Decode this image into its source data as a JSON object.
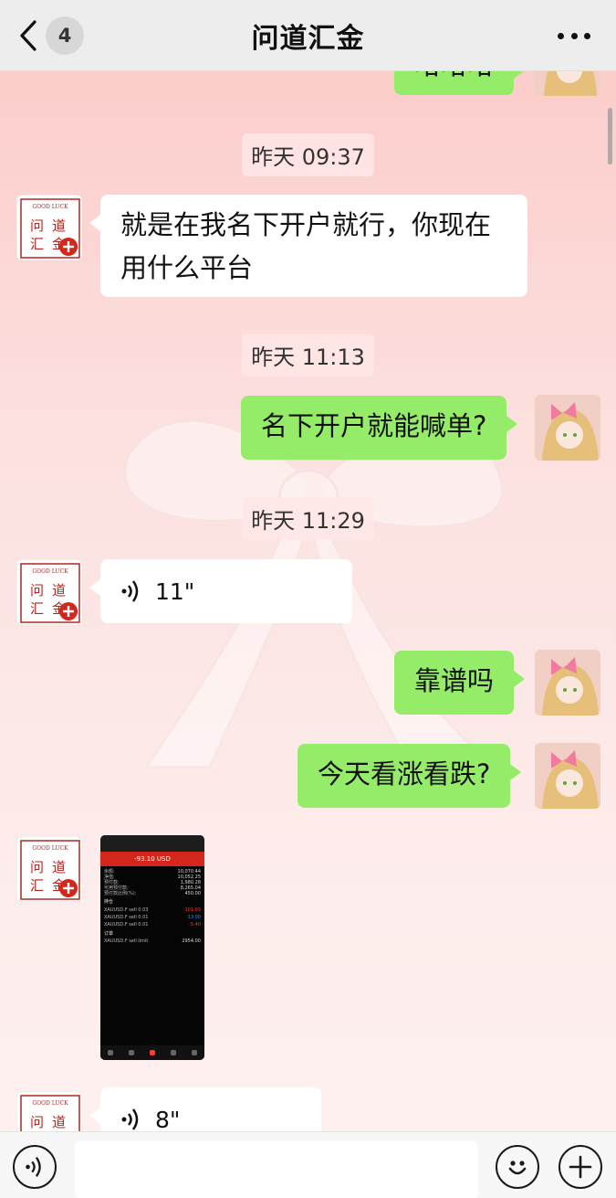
{
  "header": {
    "title": "问道汇金",
    "unread_count": "4"
  },
  "messages": {
    "partial_top": "哈哈哈",
    "ts1": "昨天 09:37",
    "m1": "就是在我名下开户就行，你现在用什么平台",
    "ts2": "昨天 11:13",
    "m2": "名下开户就能喊单?",
    "ts3": "昨天 11:29",
    "voice1": "11\"",
    "m3": "靠谱吗",
    "m4": "今天看涨看跌?",
    "voice2": "8\""
  },
  "thumbnail": {
    "header_value": "-93.10 USD",
    "rows": [
      {
        "k": "余额:",
        "v": "10,070.44"
      },
      {
        "k": "净值:",
        "v": "10,052.25"
      },
      {
        "k": "预付款:",
        "v": "1,980.28"
      },
      {
        "k": "可用预付款:",
        "v": "8,265.04"
      },
      {
        "k": "预付款比例(%):",
        "v": "450.00"
      }
    ],
    "section1": "持仓",
    "positions": [
      {
        "k": "XAUUSD.F sell 0.03",
        "v": "-101.03",
        "tone": "neg"
      },
      {
        "k": "XAUUSD.F sell 0.01",
        "v": "13.00",
        "tone": "pos"
      },
      {
        "k": "XAUUSD.F sell 0.01",
        "v": "-5.40",
        "tone": "neg"
      }
    ],
    "section2": "订单",
    "order": {
      "k": "XAUUSD.F sell limit",
      "v": "2954.00"
    }
  },
  "colors": {
    "sent_bubble": "#95ec69",
    "received_bubble": "#ffffff",
    "brand_red": "#b5251f"
  },
  "icons": [
    "back-chevron-icon",
    "more-icon",
    "voice-wave-icon",
    "voice-input-icon",
    "emoji-icon",
    "plus-icon"
  ]
}
